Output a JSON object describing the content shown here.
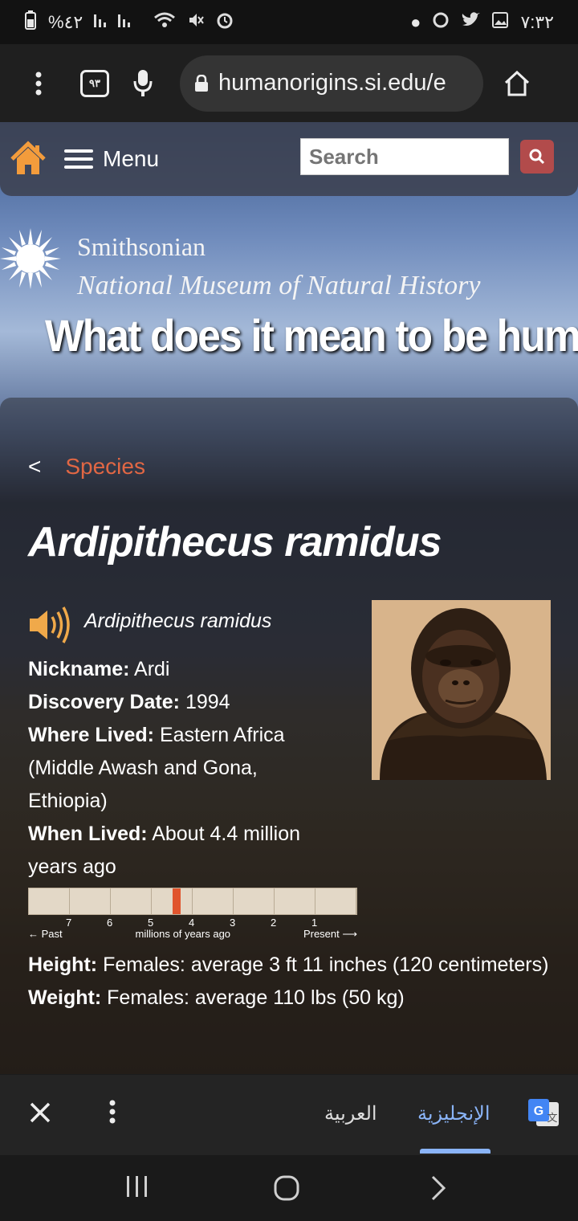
{
  "status_bar": {
    "battery": "%٤٢",
    "time": "٧:٣٢"
  },
  "browser": {
    "tab_count": "٩٣",
    "url": "humanorigins.si.edu/e"
  },
  "site_nav": {
    "menu_label": "Menu",
    "search_placeholder": "Search"
  },
  "banner": {
    "org_line1": "Smithsonian",
    "org_line2": "National Museum of Natural History",
    "tagline": "What does it mean to be human?"
  },
  "content": {
    "breadcrumb_back": "<",
    "breadcrumb": "Species",
    "title": "Ardipithecus ramidus",
    "audio_label": "Ardipithecus ramidus",
    "facts": [
      {
        "label": "Nickname:",
        "value": "Ardi"
      },
      {
        "label": "Discovery Date:",
        "value": "1994"
      },
      {
        "label": "Where Lived:",
        "value": "Eastern Africa (Middle Awash and Gona, Ethiopia)"
      },
      {
        "label": "When Lived:",
        "value": "About 4.4 million years ago"
      }
    ],
    "timeline": {
      "ticks": [
        "7",
        "6",
        "5",
        "4",
        "3",
        "2",
        "1"
      ],
      "past_label": "← Past",
      "center_label": "millions of years ago",
      "present_label": "Present ⟶",
      "marker_mya": 4.4
    },
    "facts2": [
      {
        "label": "Height:",
        "value": "Females: average 3 ft 11 inches (120 centimeters)"
      },
      {
        "label": "Weight:",
        "value": "Females: average 110 lbs (50 kg)"
      }
    ]
  },
  "translate_bar": {
    "lang_source": "العربية",
    "lang_active": "الإنجليزية"
  },
  "colors": {
    "accent": "#e16744",
    "translate_active": "#8ab4f8"
  }
}
